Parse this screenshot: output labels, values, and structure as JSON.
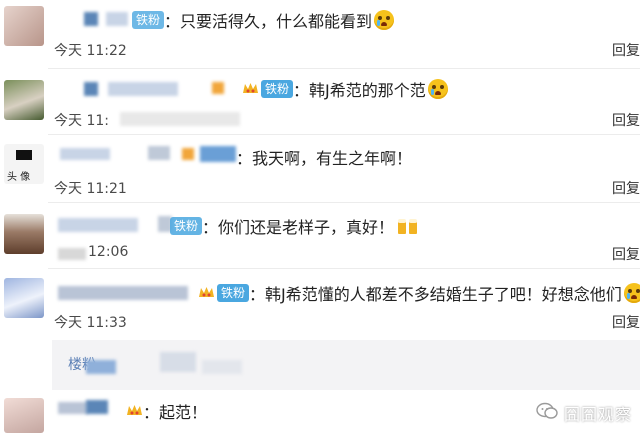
{
  "comments": [
    {
      "text": "：只要活得久，什么都能看到",
      "badge": "铁粉",
      "time": "今天 11:22",
      "reply": "回复",
      "emoji": "crying-face"
    },
    {
      "text": "：韩J希范的那个范",
      "badge": "铁粉",
      "time": "今天 11:",
      "reply": "回复",
      "emoji": "crying-face"
    },
    {
      "text": "：我天啊，有生之年啊！",
      "time": "今天 11:21",
      "reply": "回复",
      "avatar_text": "头 像"
    },
    {
      "text": "：你们还是老样子，真好！",
      "badge": "铁粉",
      "time": "12:06",
      "reply": "回复",
      "emoji": "beers"
    },
    {
      "text": "：韩J希范懂的人都差不多结婚生子了吧！好想念他们",
      "badge": "铁粉",
      "time": "今天 11:33",
      "reply": "回复",
      "emoji": "crying-face"
    },
    {
      "text": "：起范！",
      "time": "",
      "reply": ""
    }
  ],
  "reply_box": {
    "label": "楼粉"
  },
  "watermark": {
    "text": "囧囧观察",
    "icon": "wechat-icon"
  },
  "colors": {
    "badge": "#4aa7e0",
    "divider": "#ececec",
    "reply_bg": "#f3f3f5"
  }
}
